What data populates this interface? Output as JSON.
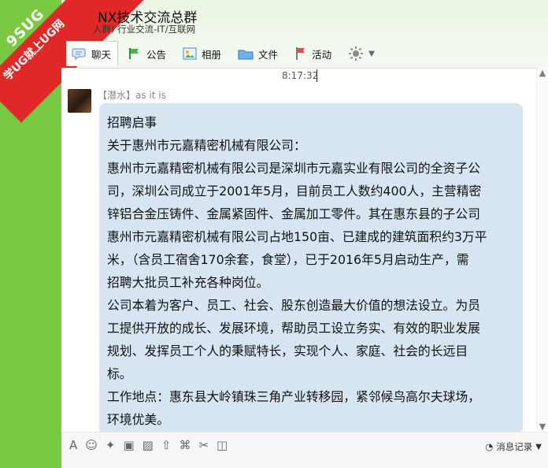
{
  "header": {
    "title": "NX技术交流总群",
    "subtitle": "人群) 行业交流-IT/互联网"
  },
  "toolbar": {
    "items": [
      {
        "label": "聊天"
      },
      {
        "label": "公告"
      },
      {
        "label": "相册"
      },
      {
        "label": "文件"
      },
      {
        "label": "活动"
      }
    ]
  },
  "chat": {
    "time": "8:17:32",
    "sender": "【潜水】as it is",
    "message_lines": [
      "招聘启事",
      "关于惠州市元嘉精密机械有限公司：",
      "惠州市元嘉精密机械有限公司是深圳市元嘉实业有限公司的全资子公",
      "司，深圳公司成立于2001年5月，目前员工人数约400人，主营精密",
      "锌铝合金压铸件、金属紧固件、金属加工零件。其在惠东县的子公司",
      "惠州市元嘉精密机械有限公司占地150亩、已建成的建筑面积约3万平",
      "米，（含员工宿舍170余套，食堂），已于2016年5月启动生产，需",
      "招聘大批员工补充各种岗位。",
      "公司本着为客户、员工、社会、股东创造最大价值的想法设立。为员",
      "工提供开放的成长、发展环境，帮助员工设立务实、有效的职业发展",
      "规划、发挥员工个人的秉赋特长，实现个人、家庭、社会的长远目",
      "标。",
      "工作地点：惠东县大岭镇珠三角产业转移园，紧邻候鸟高尔夫球场，",
      "环境优美。"
    ]
  },
  "bottom": {
    "history_label": "消息记录"
  },
  "watermark": {
    "line1": "9SUG",
    "line2": "学UG就上UG网"
  }
}
